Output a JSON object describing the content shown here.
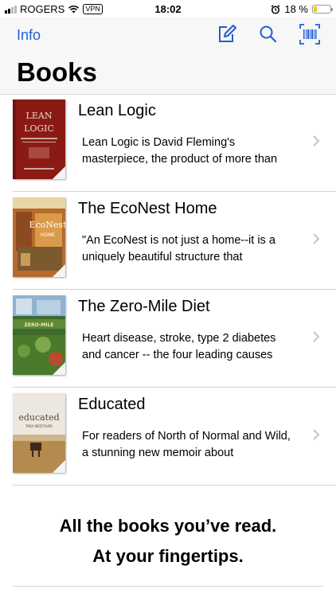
{
  "status_bar": {
    "carrier": "ROGERS",
    "vpn": "VPN",
    "time": "18:02",
    "battery": "18 %",
    "battery_level": 0.18
  },
  "nav": {
    "info_label": "Info",
    "title": "Books",
    "icons": [
      "compose-icon",
      "search-icon",
      "barcode-scan-icon"
    ]
  },
  "books": [
    {
      "title": "Lean Logic",
      "description": "Lean Logic is David Fleming's masterpiece, the product of more than",
      "cover_line1": "LEAN",
      "cover_line2": "LOGIC"
    },
    {
      "title": "The EcoNest Home",
      "description": "\"An EcoNest is not just a home--it is a uniquely beautiful structure that",
      "cover_line1": "EcoNest",
      "cover_line2": "HOME"
    },
    {
      "title": "The Zero-Mile Diet",
      "description": "Heart disease, stroke, type 2 diabetes and cancer -- the four leading causes",
      "cover_line1": "ZERO-MILE"
    },
    {
      "title": "Educated",
      "description": "For readers of North of Normal and Wild, a stunning new memoir about",
      "cover_line1": "educated",
      "cover_line2": "TARA WESTOVER"
    }
  ],
  "tagline": {
    "line1": "All the books you’ve read.",
    "line2": "At your fingertips."
  }
}
